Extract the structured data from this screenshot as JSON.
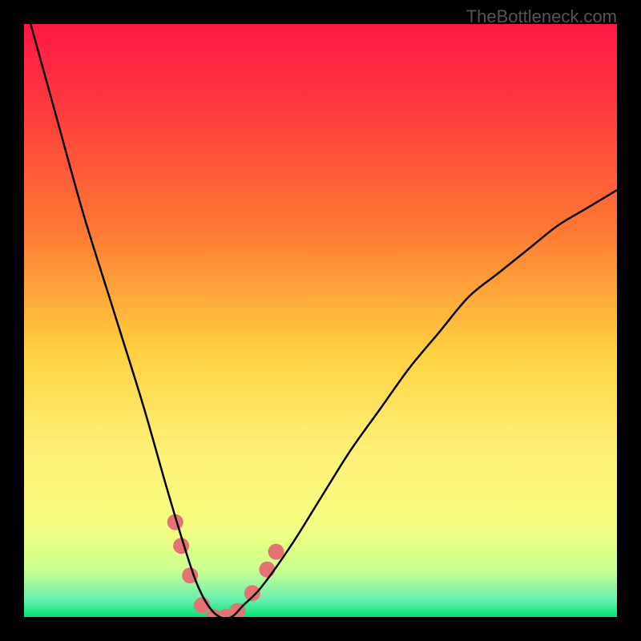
{
  "watermark": "TheBottleneck.com",
  "chart_data": {
    "type": "line",
    "title": "",
    "xlabel": "",
    "ylabel": "",
    "xlim": [
      0,
      100
    ],
    "ylim": [
      0,
      100
    ],
    "axes_visible": false,
    "grid": false,
    "legend": false,
    "background_gradient": {
      "type": "vertical",
      "stops": [
        {
          "pos": 0.0,
          "color": "#ff1744"
        },
        {
          "pos": 0.15,
          "color": "#ff3d3d"
        },
        {
          "pos": 0.35,
          "color": "#ff7a33"
        },
        {
          "pos": 0.55,
          "color": "#ffd040"
        },
        {
          "pos": 0.72,
          "color": "#fff176"
        },
        {
          "pos": 0.85,
          "color": "#f4ff81"
        },
        {
          "pos": 0.92,
          "color": "#ccff90"
        },
        {
          "pos": 0.97,
          "color": "#69f0ae"
        },
        {
          "pos": 1.0,
          "color": "#00e676"
        }
      ]
    },
    "series": [
      {
        "name": "bottleneck-curve",
        "x": [
          0,
          5,
          10,
          15,
          20,
          24,
          27,
          29,
          31,
          33,
          35,
          37,
          40,
          45,
          50,
          55,
          60,
          65,
          70,
          75,
          80,
          85,
          90,
          95,
          100
        ],
        "y": [
          104,
          86,
          68,
          52,
          36,
          22,
          12,
          6,
          2,
          0,
          0,
          2,
          5,
          12,
          20,
          28,
          35,
          42,
          48,
          54,
          58,
          62,
          66,
          69,
          72
        ],
        "color": "#000000",
        "width": 2.5
      }
    ],
    "markers": [
      {
        "x": 25.5,
        "y": 16,
        "r": 10,
        "color": "#e57373"
      },
      {
        "x": 26.5,
        "y": 12,
        "r": 10,
        "color": "#e57373"
      },
      {
        "x": 28.0,
        "y": 7,
        "r": 10,
        "color": "#e57373"
      },
      {
        "x": 30.0,
        "y": 2,
        "r": 10,
        "color": "#e57373"
      },
      {
        "x": 32.0,
        "y": 0,
        "r": 10,
        "color": "#e57373"
      },
      {
        "x": 34.0,
        "y": 0,
        "r": 10,
        "color": "#e57373"
      },
      {
        "x": 36.0,
        "y": 1,
        "r": 10,
        "color": "#e57373"
      },
      {
        "x": 38.5,
        "y": 4,
        "r": 10,
        "color": "#e57373"
      },
      {
        "x": 41.0,
        "y": 8,
        "r": 10,
        "color": "#e57373"
      },
      {
        "x": 42.5,
        "y": 11,
        "r": 10,
        "color": "#e57373"
      }
    ]
  }
}
